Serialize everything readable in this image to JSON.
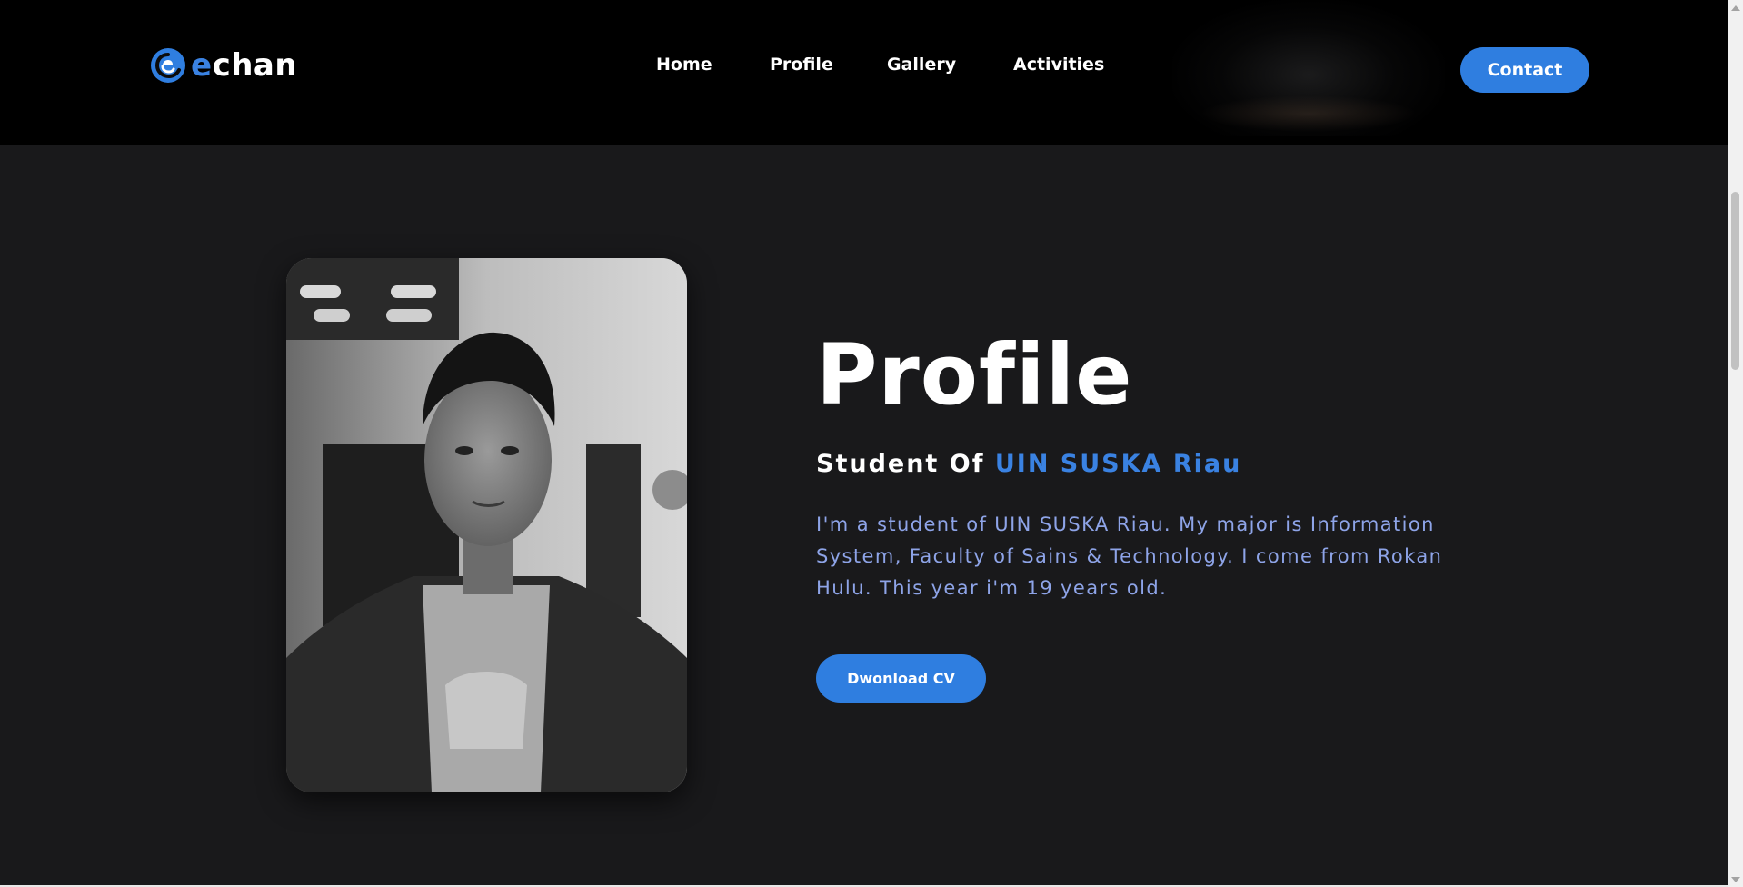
{
  "header": {
    "logo_text_e": "e",
    "logo_text_rest": "chan",
    "nav": [
      {
        "label": "Home"
      },
      {
        "label": "Profile"
      },
      {
        "label": "Gallery"
      },
      {
        "label": "Activities"
      }
    ],
    "contact_label": "Contact"
  },
  "profile": {
    "title": "Profile",
    "subtitle_prefix": "Student Of ",
    "subtitle_accent": "UIN SUSKA Riau",
    "bio": "I'm a student of UIN SUSKA Riau. My major is Information System, Faculty of Sains & Technology. I come from Rokan Hulu. This year i'm 19 years old.",
    "cv_button_label": "Dwonload CV"
  },
  "colors": {
    "accent": "#2f7ee0",
    "header_bg": "#000000",
    "page_bg": "#19191b",
    "bio_text": "#8ea4e8"
  }
}
